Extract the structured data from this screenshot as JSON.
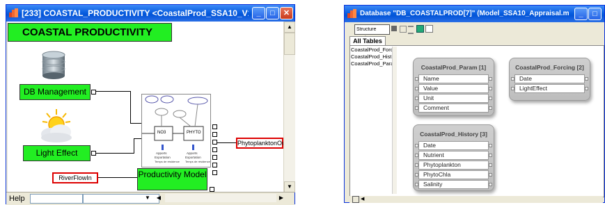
{
  "left_window": {
    "title": "[233] COASTAL_PRODUCTIVITY   <CoastalProd_SSA10_V1>   <...",
    "header": "COASTAL PRODUCTIVITY",
    "blocks": {
      "db_management": "DB Management",
      "light_effect": "Light Effect",
      "productivity_model": "Productivity Model",
      "phytoplankton_out": "PhytoplanktonOut",
      "river_flow_in": "RiverFlowIn"
    },
    "inner_diagram": {
      "nodes": [
        "NO3",
        "PHYTO"
      ],
      "small_labels": [
        "Apports",
        "Exportation",
        "Temps de résidence"
      ]
    },
    "status": {
      "help_label": "Help"
    }
  },
  "right_window": {
    "title": "Database \"DB_COASTALPROD[7]\" (Model_SSA10_Appraisal.mox)",
    "toolbar": {
      "mode_label": "Structure mode"
    },
    "tab_label": "All Tables",
    "table_list": [
      "CoastalProd_Forc",
      "CoastalProd_Hist",
      "CoastalProd_Para"
    ],
    "tables": [
      {
        "name": "CoastalProd_Param [1]",
        "fields": [
          "Name",
          "Value",
          "Unit",
          "Comment"
        ]
      },
      {
        "name": "CoastalProd_Forcing [2]",
        "fields": [
          "Date",
          "LightEffect"
        ]
      },
      {
        "name": "CoastalProd_History [3]",
        "fields": [
          "Date",
          "Nutrient",
          "Phytoplankton",
          "PhytoChla",
          "Salinity"
        ]
      }
    ]
  },
  "colors": {
    "title_blue": "#0a5fe0",
    "block_green": "#22ee22",
    "port_red": "#dd0000",
    "chrome": "#ece9d8"
  },
  "icons": [
    "database-icon",
    "weather-icon",
    "minimize-icon",
    "maximize-icon",
    "close-icon"
  ]
}
